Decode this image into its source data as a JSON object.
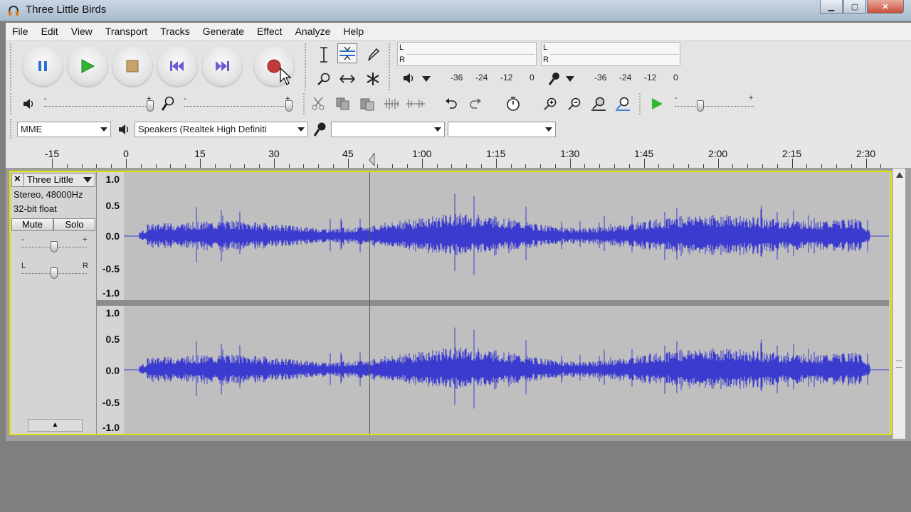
{
  "window": {
    "title": "Three Little Birds",
    "controls": [
      "minimize",
      "maximize",
      "close"
    ]
  },
  "menu": {
    "items": [
      "File",
      "Edit",
      "View",
      "Transport",
      "Tracks",
      "Generate",
      "Effect",
      "Analyze",
      "Help"
    ]
  },
  "transport": {
    "buttons": [
      "pause",
      "play",
      "stop",
      "skip-to-start",
      "skip-to-end",
      "record"
    ]
  },
  "meters": {
    "playback": {
      "left_label": "L",
      "right_label": "R",
      "scale": [
        "-36",
        "-24",
        "-12",
        "0"
      ]
    },
    "record": {
      "left_label": "L",
      "right_label": "R",
      "scale": [
        "-36",
        "-24",
        "-12",
        "0"
      ]
    }
  },
  "mixer": {
    "output_min": "-",
    "output_max": "+",
    "input_min": "-",
    "input_max": "+"
  },
  "device": {
    "host": "MME",
    "output": "Speakers (Realtek High Definiti",
    "input": "",
    "channels": ""
  },
  "speed": {
    "min": "-",
    "max": "+"
  },
  "ruler": {
    "labels": [
      "-15",
      "0",
      "15",
      "30",
      "45",
      "1:00",
      "1:15",
      "1:30",
      "1:45",
      "2:00",
      "2:15",
      "2:30"
    ]
  },
  "track": {
    "name": "Three Little",
    "info_rate": "Stereo, 48000Hz",
    "info_format": "32-bit float",
    "mute_label": "Mute",
    "solo_label": "Solo",
    "gain_min": "-",
    "gain_max": "+",
    "pan_left": "L",
    "pan_right": "R",
    "collapse_glyph": "▲",
    "axis_labels": [
      "1.0",
      "0.5",
      "0.0",
      "-0.5",
      "-1.0"
    ],
    "waveform_color": "#3b3bcf",
    "cursor_time_seconds": 49
  },
  "colors": {
    "selected_border": "#e1e100",
    "waveform": "#3b3bcf",
    "play_green": "#2fb82f",
    "record_red": "#c03a3a",
    "pause_blue": "#2a6fd6"
  }
}
